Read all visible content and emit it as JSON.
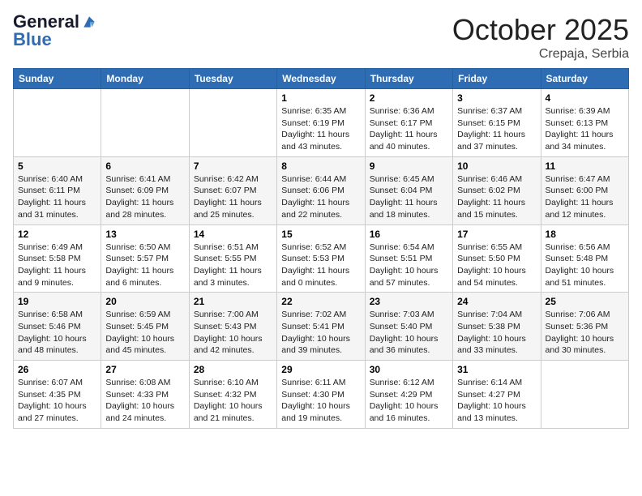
{
  "header": {
    "logo_line1": "General",
    "logo_line2": "Blue",
    "month": "October 2025",
    "location": "Crepaja, Serbia"
  },
  "weekdays": [
    "Sunday",
    "Monday",
    "Tuesday",
    "Wednesday",
    "Thursday",
    "Friday",
    "Saturday"
  ],
  "weeks": [
    [
      {
        "day": "",
        "info": ""
      },
      {
        "day": "",
        "info": ""
      },
      {
        "day": "",
        "info": ""
      },
      {
        "day": "1",
        "info": "Sunrise: 6:35 AM\nSunset: 6:19 PM\nDaylight: 11 hours and 43 minutes."
      },
      {
        "day": "2",
        "info": "Sunrise: 6:36 AM\nSunset: 6:17 PM\nDaylight: 11 hours and 40 minutes."
      },
      {
        "day": "3",
        "info": "Sunrise: 6:37 AM\nSunset: 6:15 PM\nDaylight: 11 hours and 37 minutes."
      },
      {
        "day": "4",
        "info": "Sunrise: 6:39 AM\nSunset: 6:13 PM\nDaylight: 11 hours and 34 minutes."
      }
    ],
    [
      {
        "day": "5",
        "info": "Sunrise: 6:40 AM\nSunset: 6:11 PM\nDaylight: 11 hours and 31 minutes."
      },
      {
        "day": "6",
        "info": "Sunrise: 6:41 AM\nSunset: 6:09 PM\nDaylight: 11 hours and 28 minutes."
      },
      {
        "day": "7",
        "info": "Sunrise: 6:42 AM\nSunset: 6:07 PM\nDaylight: 11 hours and 25 minutes."
      },
      {
        "day": "8",
        "info": "Sunrise: 6:44 AM\nSunset: 6:06 PM\nDaylight: 11 hours and 22 minutes."
      },
      {
        "day": "9",
        "info": "Sunrise: 6:45 AM\nSunset: 6:04 PM\nDaylight: 11 hours and 18 minutes."
      },
      {
        "day": "10",
        "info": "Sunrise: 6:46 AM\nSunset: 6:02 PM\nDaylight: 11 hours and 15 minutes."
      },
      {
        "day": "11",
        "info": "Sunrise: 6:47 AM\nSunset: 6:00 PM\nDaylight: 11 hours and 12 minutes."
      }
    ],
    [
      {
        "day": "12",
        "info": "Sunrise: 6:49 AM\nSunset: 5:58 PM\nDaylight: 11 hours and 9 minutes."
      },
      {
        "day": "13",
        "info": "Sunrise: 6:50 AM\nSunset: 5:57 PM\nDaylight: 11 hours and 6 minutes."
      },
      {
        "day": "14",
        "info": "Sunrise: 6:51 AM\nSunset: 5:55 PM\nDaylight: 11 hours and 3 minutes."
      },
      {
        "day": "15",
        "info": "Sunrise: 6:52 AM\nSunset: 5:53 PM\nDaylight: 11 hours and 0 minutes."
      },
      {
        "day": "16",
        "info": "Sunrise: 6:54 AM\nSunset: 5:51 PM\nDaylight: 10 hours and 57 minutes."
      },
      {
        "day": "17",
        "info": "Sunrise: 6:55 AM\nSunset: 5:50 PM\nDaylight: 10 hours and 54 minutes."
      },
      {
        "day": "18",
        "info": "Sunrise: 6:56 AM\nSunset: 5:48 PM\nDaylight: 10 hours and 51 minutes."
      }
    ],
    [
      {
        "day": "19",
        "info": "Sunrise: 6:58 AM\nSunset: 5:46 PM\nDaylight: 10 hours and 48 minutes."
      },
      {
        "day": "20",
        "info": "Sunrise: 6:59 AM\nSunset: 5:45 PM\nDaylight: 10 hours and 45 minutes."
      },
      {
        "day": "21",
        "info": "Sunrise: 7:00 AM\nSunset: 5:43 PM\nDaylight: 10 hours and 42 minutes."
      },
      {
        "day": "22",
        "info": "Sunrise: 7:02 AM\nSunset: 5:41 PM\nDaylight: 10 hours and 39 minutes."
      },
      {
        "day": "23",
        "info": "Sunrise: 7:03 AM\nSunset: 5:40 PM\nDaylight: 10 hours and 36 minutes."
      },
      {
        "day": "24",
        "info": "Sunrise: 7:04 AM\nSunset: 5:38 PM\nDaylight: 10 hours and 33 minutes."
      },
      {
        "day": "25",
        "info": "Sunrise: 7:06 AM\nSunset: 5:36 PM\nDaylight: 10 hours and 30 minutes."
      }
    ],
    [
      {
        "day": "26",
        "info": "Sunrise: 6:07 AM\nSunset: 4:35 PM\nDaylight: 10 hours and 27 minutes."
      },
      {
        "day": "27",
        "info": "Sunrise: 6:08 AM\nSunset: 4:33 PM\nDaylight: 10 hours and 24 minutes."
      },
      {
        "day": "28",
        "info": "Sunrise: 6:10 AM\nSunset: 4:32 PM\nDaylight: 10 hours and 21 minutes."
      },
      {
        "day": "29",
        "info": "Sunrise: 6:11 AM\nSunset: 4:30 PM\nDaylight: 10 hours and 19 minutes."
      },
      {
        "day": "30",
        "info": "Sunrise: 6:12 AM\nSunset: 4:29 PM\nDaylight: 10 hours and 16 minutes."
      },
      {
        "day": "31",
        "info": "Sunrise: 6:14 AM\nSunset: 4:27 PM\nDaylight: 10 hours and 13 minutes."
      },
      {
        "day": "",
        "info": ""
      }
    ]
  ]
}
